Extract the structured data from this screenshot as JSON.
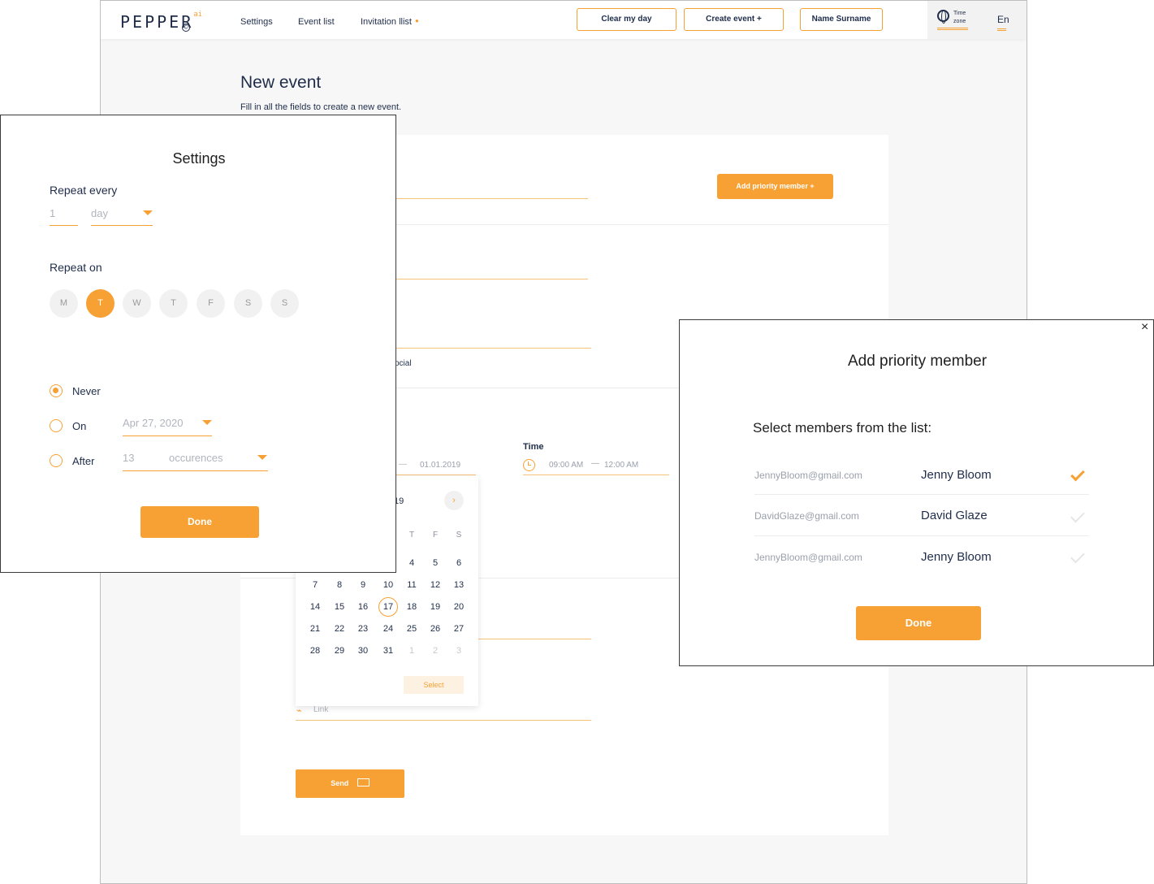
{
  "app": {
    "logo": "PEPPER",
    "logo_sup": "ai",
    "nav": [
      "Settings",
      "Event list",
      "Invitation llist"
    ],
    "buttons": {
      "clear": "Clear my day",
      "create": "Create event +",
      "profile": "Name Surname"
    },
    "timezone": {
      "line1": "Time",
      "line2": "zone"
    },
    "language": "En"
  },
  "page": {
    "title": "New event",
    "subtitle": "Fill in all the fields to create a new event.",
    "add_priority_label": "Add priority member +",
    "partial_social": "ocial",
    "date_value": "01.01.2019",
    "time_label": "Time",
    "time_start": "09:00 AM",
    "time_end": "12:00 AM",
    "link_placeholder": "Link",
    "send_label": "Send"
  },
  "calendar": {
    "month_partial": "19",
    "weekday_heads": [
      "T",
      "F",
      "S"
    ],
    "rows": [
      [
        "",
        "",
        "",
        "",
        "4",
        "5",
        "6"
      ],
      [
        "7",
        "8",
        "9",
        "10",
        "11",
        "12",
        "13"
      ],
      [
        "14",
        "15",
        "16",
        "17",
        "18",
        "19",
        "20"
      ],
      [
        "21",
        "22",
        "23",
        "24",
        "25",
        "26",
        "27"
      ],
      [
        "28",
        "29",
        "30",
        "31",
        "1",
        "2",
        "3"
      ]
    ],
    "selected": "17",
    "select_label": "Select"
  },
  "settings": {
    "title": "Settings",
    "repeat_every_label": "Repeat every",
    "repeat_count": "1",
    "repeat_unit": "day",
    "repeat_on_label": "Repeat on",
    "days": [
      "M",
      "T",
      "W",
      "T",
      "F",
      "S",
      "S"
    ],
    "active_day_index": 1,
    "end_options": {
      "never": "Never",
      "on": "On",
      "on_date": "Apr 27, 2020",
      "after": "After",
      "after_count": "13",
      "after_unit": "occurences"
    },
    "selected_end": "never",
    "done_label": "Done"
  },
  "priority": {
    "title": "Add priority member",
    "subtitle": "Select members from the list:",
    "members": [
      {
        "email": "JennyBloom@gmail.com",
        "name": "Jenny Bloom",
        "checked": true
      },
      {
        "email": "DavidGlaze@gmail.com",
        "name": "David Glaze",
        "checked": false
      },
      {
        "email": "JennyBloom@gmail.com",
        "name": "Jenny Bloom",
        "checked": false
      }
    ],
    "done_label": "Done",
    "close_icon": "×"
  },
  "colors": {
    "accent": "#f7a033",
    "text": "#1f2d4a",
    "muted": "#9aa0ab"
  }
}
